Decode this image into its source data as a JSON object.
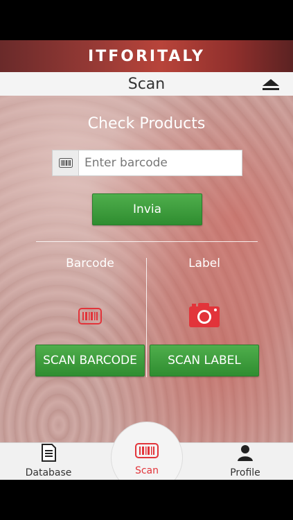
{
  "brand": {
    "logo_text": "ITFORITALY"
  },
  "header": {
    "title": "Scan",
    "eject_icon": "eject-icon"
  },
  "main": {
    "heading": "Check Products",
    "barcode_field": {
      "placeholder": "Enter barcode",
      "value": "",
      "icon": "barcode-icon"
    },
    "submit_label": "Invia",
    "barcode_column": {
      "label": "Barcode",
      "icon": "barcode-icon",
      "button_label": "SCAN BARCODE"
    },
    "label_column": {
      "label": "Label",
      "icon": "camera-icon",
      "button_label": "SCAN LABEL"
    }
  },
  "tabs": [
    {
      "label": "Database",
      "icon": "document-icon"
    },
    {
      "label": "Scan",
      "icon": "barcode-icon",
      "active": true
    },
    {
      "label": "Profile",
      "icon": "user-icon"
    }
  ],
  "colors": {
    "accent_red": "#e2343a",
    "button_green": "#3b9b3a",
    "brand_red": "#a53b35"
  }
}
